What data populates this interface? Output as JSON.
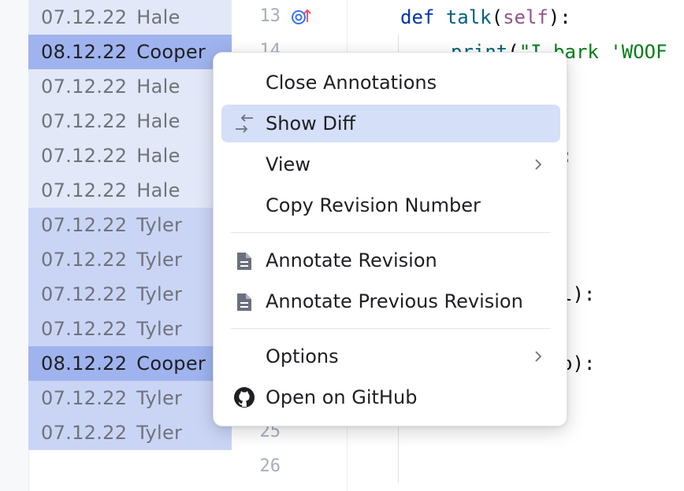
{
  "annotations": [
    {
      "date": "07.12.22",
      "author": "Hale",
      "style": "hale"
    },
    {
      "date": "08.12.22",
      "author": "Cooper",
      "style": "cooper"
    },
    {
      "date": "07.12.22",
      "author": "Hale",
      "style": "hale"
    },
    {
      "date": "07.12.22",
      "author": "Hale",
      "style": "hale"
    },
    {
      "date": "07.12.22",
      "author": "Hale",
      "style": "hale"
    },
    {
      "date": "07.12.22",
      "author": "Hale",
      "style": "hale"
    },
    {
      "date": "07.12.22",
      "author": "Tyler",
      "style": "tyler"
    },
    {
      "date": "07.12.22",
      "author": "Tyler",
      "style": "tyler"
    },
    {
      "date": "07.12.22",
      "author": "Tyler",
      "style": "tyler"
    },
    {
      "date": "07.12.22",
      "author": "Tyler",
      "style": "tyler"
    },
    {
      "date": "08.12.22",
      "author": "Cooper",
      "style": "cooper"
    },
    {
      "date": "07.12.22",
      "author": "Tyler",
      "style": "tyler"
    },
    {
      "date": "07.12.22",
      "author": "Tyler",
      "style": "tyler"
    }
  ],
  "line_numbers": [
    "13",
    "14",
    "25",
    "26"
  ],
  "code": {
    "line1": {
      "kw": "def",
      "fn": "talk",
      "open": "(",
      "self": "self",
      "close": "):"
    },
    "line2": {
      "fn": "print",
      "open": "(",
      "str": "\"I bark 'WOOF"
    },
    "frag_colon": ":",
    "frag_l": "l):",
    "frag_o": "o):"
  },
  "menu": {
    "items": [
      {
        "label": "Close Annotations"
      },
      {
        "label": "Show Diff",
        "icon": "diff-arrows-icon",
        "selected": true
      },
      {
        "label": "View",
        "submenu": true
      },
      {
        "label": "Copy Revision Number"
      },
      {
        "label": "Annotate Revision",
        "icon": "document-icon"
      },
      {
        "label": "Annotate Previous Revision",
        "icon": "document-icon"
      },
      {
        "label": "Options",
        "submenu": true
      },
      {
        "label": "Open on GitHub",
        "icon": "github-icon"
      }
    ]
  },
  "colors": {
    "selected_item": "#d5dff8",
    "hale_row": "#e3e8f8",
    "tyler_row": "#cad5f6",
    "cooper_row": "#9fb3ee"
  }
}
